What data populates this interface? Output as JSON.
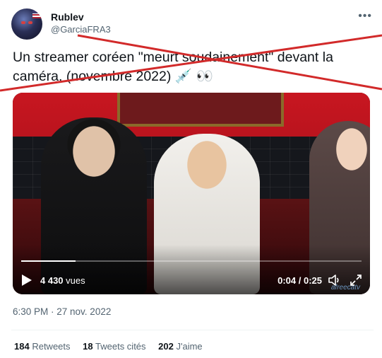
{
  "user": {
    "name": "Rublev",
    "handle": "@GarciaFRA3"
  },
  "more_icon": "more-horizontal-icon",
  "tweet": {
    "text": "Un streamer coréen \"meurt soudainement\" devant la caméra. (novembre 2022) 💉 👀",
    "strike_color": "#d22a2a"
  },
  "video": {
    "views_count": "4 430",
    "views_label": "vues",
    "time": "0:04 / 0:25",
    "progress": 0.16,
    "watermark": "afreecatv"
  },
  "timestamp": "6:30 PM · 27 nov. 2022",
  "stats": {
    "retweets_count": "184",
    "retweets_label": "Retweets",
    "quotes_count": "18",
    "quotes_label": "Tweets cités",
    "likes_count": "202",
    "likes_label": "J'aime"
  },
  "colors": {
    "text": "#0f1419",
    "muted": "#536471",
    "divider": "#eff3f4"
  }
}
